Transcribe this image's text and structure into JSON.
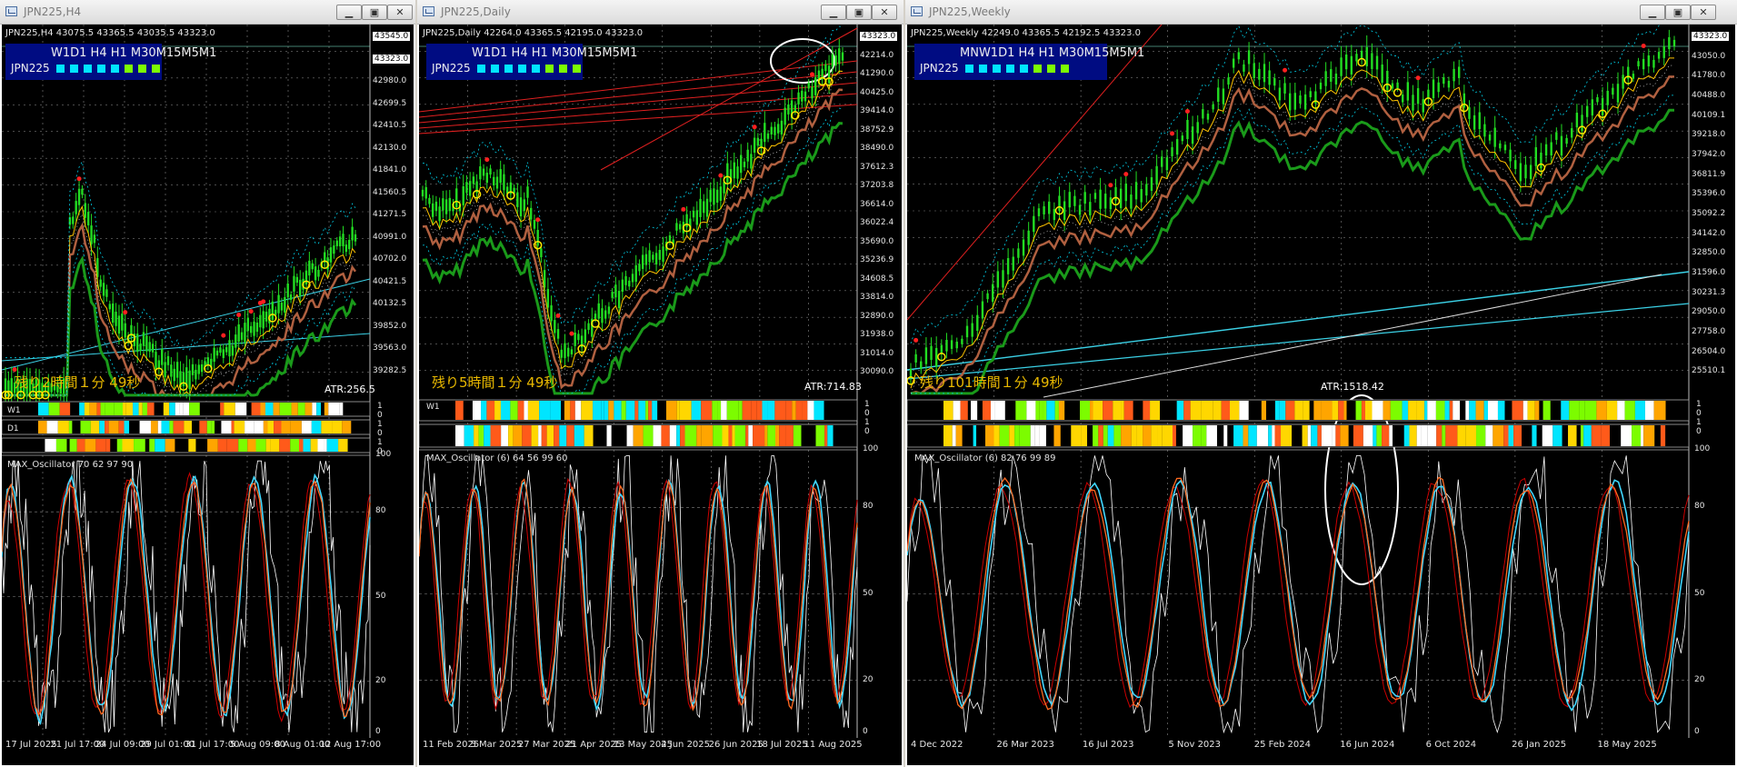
{
  "windows": [
    {
      "title": "JPN225,H4",
      "ohlc": "JPN225,H4  43075.5 43365.5 43035.5 43323.0",
      "tf_label": "W1D1 H4 H1 M30M15M5M1",
      "symbol": "JPN225",
      "remaining": "残り2時間１分 49秒",
      "atr": "ATR:256.5",
      "oscillator": "MAX_Oscillator 70 62 97 90",
      "band_labels": [
        "W1",
        "D1"
      ],
      "price_labels": [
        "43545.0",
        "43323.0",
        "42980.0",
        "42699.5",
        "42410.5",
        "42130.0",
        "41841.0",
        "41560.5",
        "41271.5",
        "40991.0",
        "40702.0",
        "40421.5",
        "40132.5",
        "39852.0",
        "39563.0",
        "39282.5"
      ],
      "band_scale": [
        "1",
        "0",
        "1",
        "0",
        "1",
        "0"
      ],
      "osc_scale": [
        "100",
        "80",
        "50",
        "20",
        "0"
      ],
      "time_labels": [
        "17 Jul 2025",
        "21 Jul 17:00",
        "24 Jul 09:00",
        "29 Jul 01:00",
        "31 Jul 17:00",
        "5 Aug 09:00",
        "8 Aug 01:00",
        "12 Aug 17:00"
      ]
    },
    {
      "title": "JPN225,Daily",
      "ohlc": "JPN225,Daily  42264.0 43365.5 42195.0 43323.0",
      "tf_label": "W1D1 H4 H1 M30M15M5M1",
      "symbol": "JPN225",
      "remaining": "残り5時間１分 49秒",
      "atr": "ATR:714.83",
      "oscillator": "MAX_Oscillator (6) 64 56 99 60",
      "band_labels": [
        "W1"
      ],
      "price_labels": [
        "43323.0",
        "42214.0",
        "41290.0",
        "40425.0",
        "39414.0",
        "38752.9",
        "38490.0",
        "37612.3",
        "37203.8",
        "36614.0",
        "36022.4",
        "35690.0",
        "35236.9",
        "34608.5",
        "33814.0",
        "32890.0",
        "31938.0",
        "31014.0",
        "30090.0"
      ],
      "band_scale": [
        "1",
        "0",
        "1",
        "0"
      ],
      "osc_scale": [
        "100",
        "80",
        "50",
        "20",
        "0"
      ],
      "time_labels": [
        "11 Feb 2025",
        "5 Mar 2025",
        "27 Mar 2025",
        "21 Apr 2025",
        "13 May 2025",
        "4 Jun 2025",
        "26 Jun 2025",
        "18 Jul 2025",
        "11 Aug 2025"
      ]
    },
    {
      "title": "JPN225,Weekly",
      "ohlc": "JPN225,Weekly  42249.0 43365.5 42192.5 43323.0",
      "tf_label": "MNW1D1 H4 H1 M30M15M5M1",
      "symbol": "JPN225",
      "remaining": "残り101時間１分 49秒",
      "atr": "ATR:1518.42",
      "oscillator": "MAX_Oscillator (6) 82 76 99 89",
      "band_labels": [],
      "price_labels": [
        "43323.0",
        "43050.0",
        "41780.0",
        "40488.0",
        "40109.1",
        "39218.0",
        "37942.0",
        "36811.9",
        "35396.0",
        "35092.2",
        "34142.0",
        "32850.0",
        "31596.0",
        "30231.3",
        "29050.0",
        "27758.0",
        "26504.0",
        "25510.1"
      ],
      "band_scale": [
        "1",
        "0",
        "1",
        "0"
      ],
      "osc_scale": [
        "100",
        "80",
        "50",
        "20",
        "0"
      ],
      "time_labels": [
        "4 Dec 2022",
        "26 Mar 2023",
        "16 Jul 2023",
        "5 Nov 2023",
        "25 Feb 2024",
        "16 Jun 2024",
        "6 Oct 2024",
        "26 Jan 2025",
        "18 May 2025"
      ]
    }
  ],
  "window_buttons": [
    "minimize",
    "restore",
    "close"
  ],
  "colors": {
    "background": "#000000",
    "candle": "#22dd22",
    "accent_line": "#00e0ff",
    "ma_brown": "#b06040",
    "ma_green": "#1a9a1a",
    "remaining_text": "#e8b800",
    "tf_panel": "#000c82",
    "osc_red": "#cc0000",
    "osc_cyan": "#40d8ff",
    "osc_white": "#ffffff",
    "band_colors": [
      "#ff5a1a",
      "#ffa500",
      "#ffffff",
      "#00e5ff",
      "#7cfc00",
      "#ffd700",
      "#000000"
    ]
  }
}
